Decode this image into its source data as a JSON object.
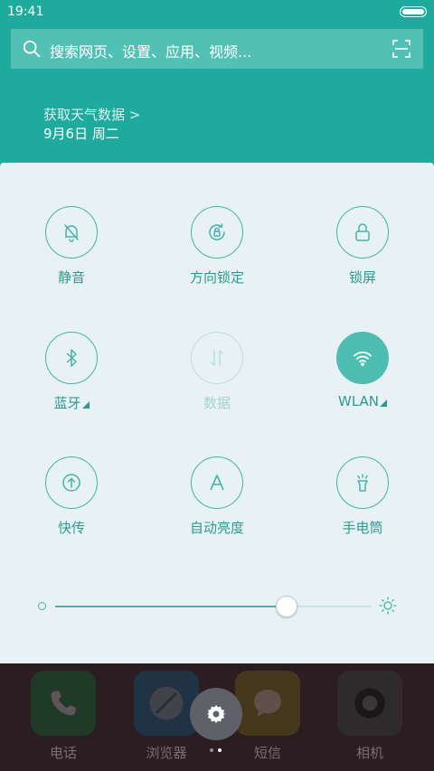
{
  "status_bar": {
    "time": "19:41"
  },
  "search": {
    "placeholder": "搜索网页、设置、应用、视频..."
  },
  "weather": {
    "link": "获取天气数据 >",
    "date": "9月6日 周二"
  },
  "tiles": [
    {
      "label": "静音",
      "icon": "bell-off-icon",
      "state": "off"
    },
    {
      "label": "方向锁定",
      "icon": "rotation-lock-icon",
      "state": "off"
    },
    {
      "label": "锁屏",
      "icon": "lock-icon",
      "state": "off"
    },
    {
      "label": "蓝牙",
      "icon": "bluetooth-icon",
      "state": "off",
      "has_menu": true
    },
    {
      "label": "数据",
      "icon": "mobile-data-icon",
      "state": "disabled"
    },
    {
      "label": "WLAN",
      "icon": "wifi-icon",
      "state": "on",
      "has_menu": true
    },
    {
      "label": "快传",
      "icon": "transfer-icon",
      "state": "off"
    },
    {
      "label": "自动亮度",
      "icon": "auto-brightness-icon",
      "state": "off"
    },
    {
      "label": "手电筒",
      "icon": "flashlight-icon",
      "state": "off"
    }
  ],
  "brightness": {
    "level": 0.73
  },
  "dock": {
    "apps": [
      {
        "label": "电话",
        "icon": "phone-icon"
      },
      {
        "label": "浏览器",
        "icon": "browser-icon"
      },
      {
        "label": "短信",
        "icon": "sms-icon"
      },
      {
        "label": "相机",
        "icon": "camera-icon"
      }
    ]
  },
  "colors": {
    "accent": "#1eab9d",
    "panel": "#e8f2f4",
    "tile_border": "#45b3a8"
  }
}
